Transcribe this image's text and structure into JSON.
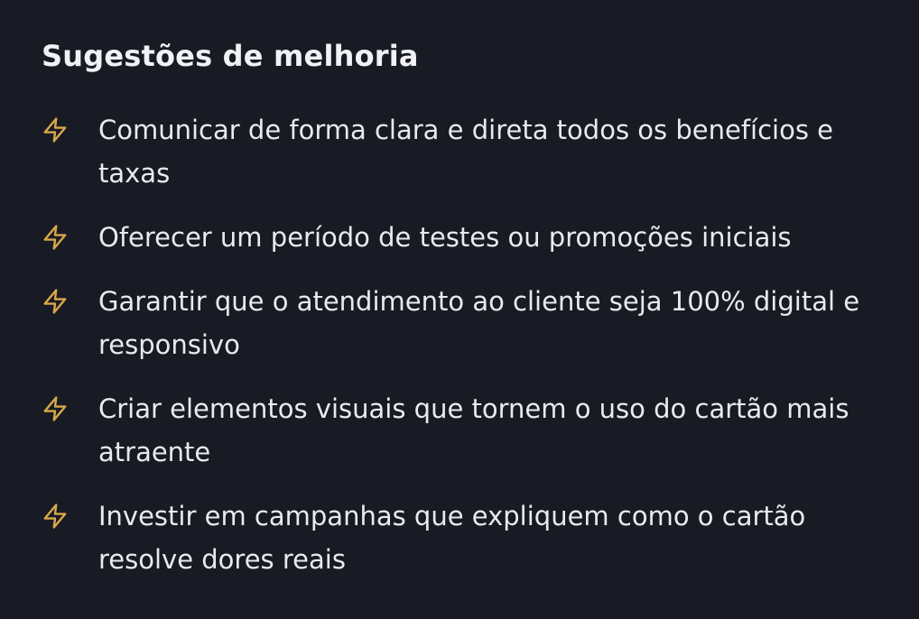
{
  "title": "Sugestões de melhoria",
  "accent_color": "#d9a84a",
  "items": [
    {
      "icon": "lightning-icon",
      "text": "Comunicar de forma clara e direta todos os benefícios e taxas"
    },
    {
      "icon": "lightning-icon",
      "text": "Oferecer um período de testes ou promoções iniciais"
    },
    {
      "icon": "lightning-icon",
      "text": "Garantir que o atendimento ao cliente seja 100% digital e responsivo"
    },
    {
      "icon": "lightning-icon",
      "text": "Criar elementos visuais que tornem o uso do cartão mais atraente"
    },
    {
      "icon": "lightning-icon",
      "text": "Investir em campanhas que expliquem como o cartão resolve dores reais"
    }
  ]
}
